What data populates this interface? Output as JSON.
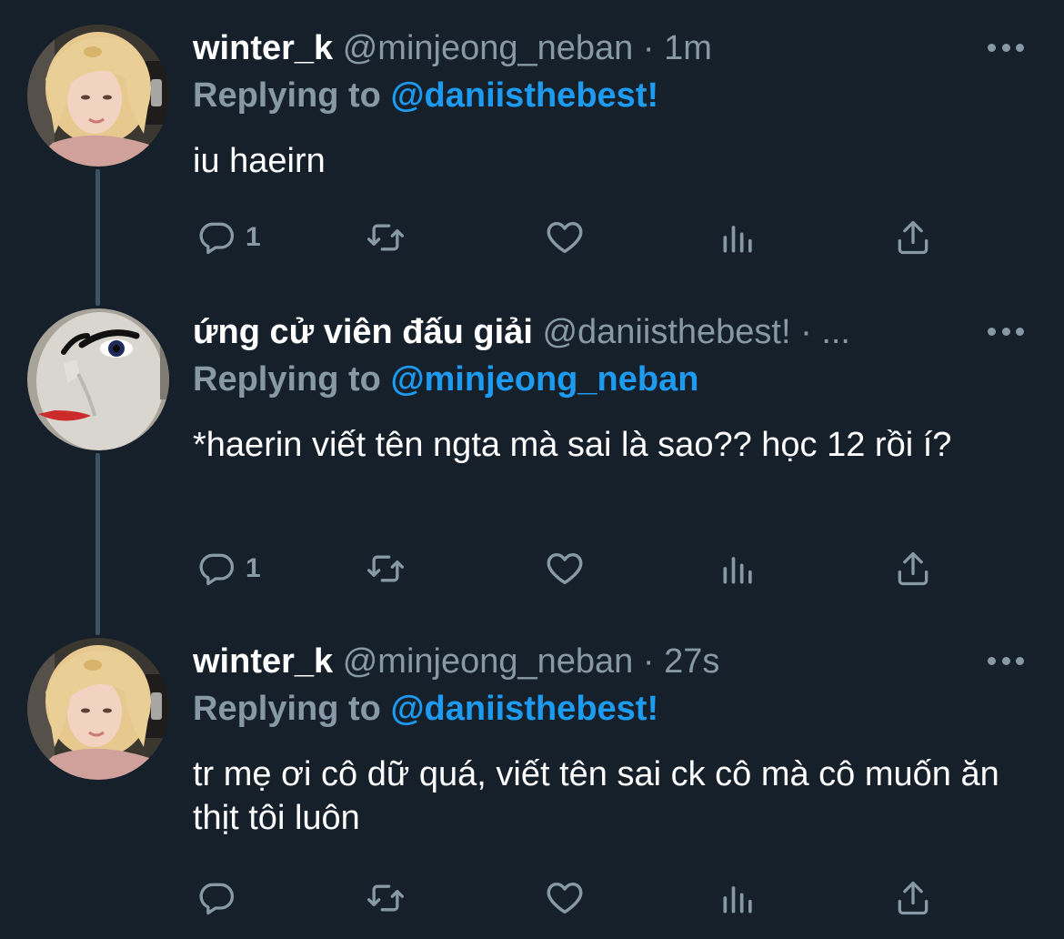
{
  "tweets": [
    {
      "name": "winter_k",
      "handle": "@minjeong_neban",
      "dot": "·",
      "time": "1m",
      "reply_prefix": "Replying to",
      "reply_target": "@daniisthebest!",
      "text": "iu haeirn",
      "actions": {
        "reply_count": "1"
      },
      "avatar": "blonde-woman-avatar"
    },
    {
      "name": "ứng cử viên đấu giải",
      "handle": "@daniisthebest!",
      "dot": "·",
      "time": "...",
      "reply_prefix": "Replying to",
      "reply_target": "@minjeong_neban",
      "text": "*haerin viết tên ngta mà sai là sao?? học 12 rồi í?",
      "actions": {
        "reply_count": "1"
      },
      "avatar": "cartoon-face-avatar"
    },
    {
      "name": "winter_k",
      "handle": "@minjeong_neban",
      "dot": "·",
      "time": "27s",
      "reply_prefix": "Replying to",
      "reply_target": "@daniisthebest!",
      "text": "tr mẹ ơi cô dữ quá, viết tên sai ck cô mà cô muốn ăn thịt tôi luôn",
      "actions": {
        "reply_count": ""
      },
      "avatar": "blonde-woman-avatar"
    }
  ],
  "colors": {
    "background": "#15202b",
    "secondary_text": "#8899a6",
    "accent": "#1d9bf0",
    "thread_line": "#3d5466"
  },
  "icons": [
    "reply-icon",
    "retweet-icon",
    "like-icon",
    "views-icon",
    "share-icon",
    "more-icon"
  ]
}
